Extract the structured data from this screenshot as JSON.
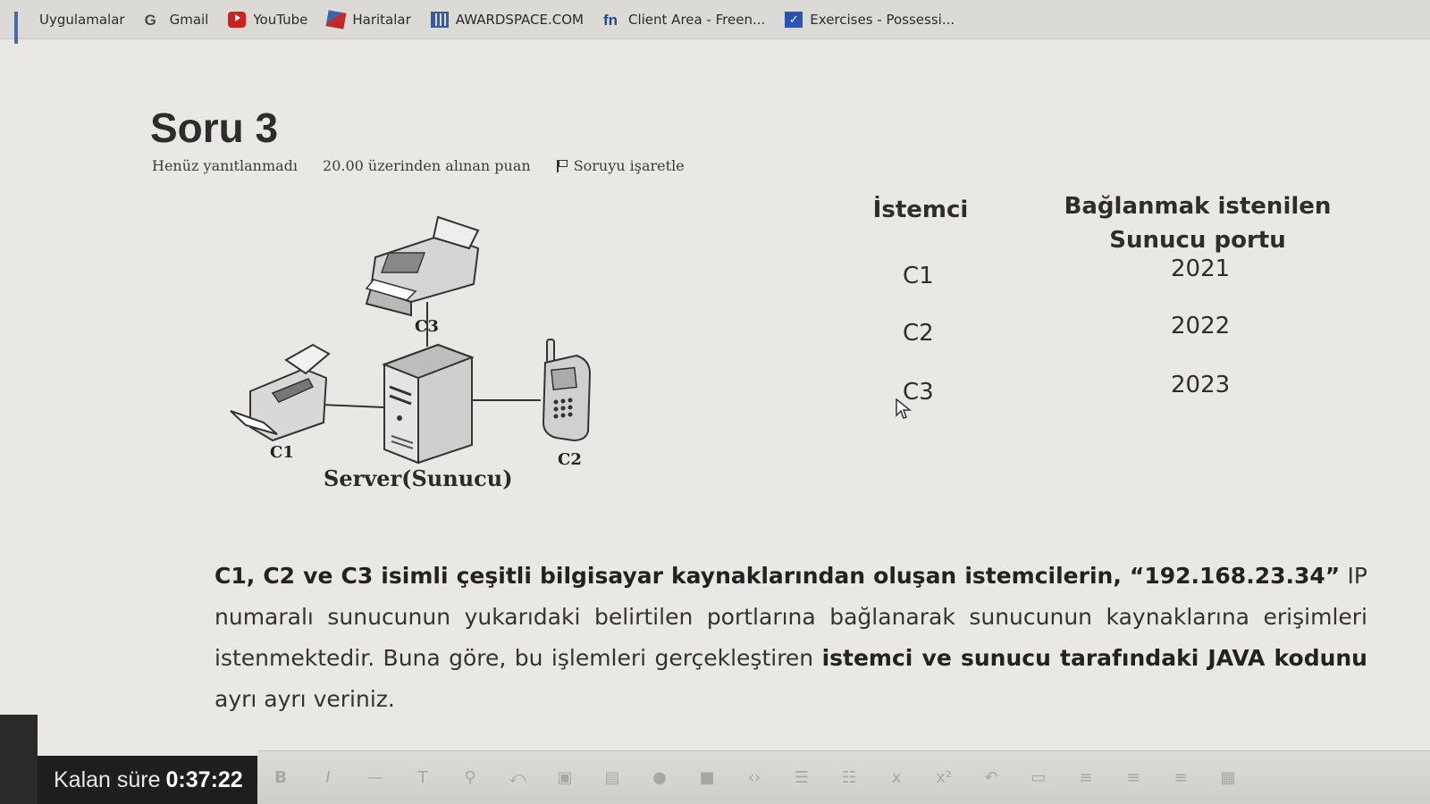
{
  "bookmarks": [
    {
      "label": "Uygulamalar",
      "icon": "apps-grid-icon"
    },
    {
      "label": "Gmail",
      "icon": "google-icon"
    },
    {
      "label": "YouTube",
      "icon": "youtube-icon"
    },
    {
      "label": "Haritalar",
      "icon": "maps-icon"
    },
    {
      "label": "AWARDSPACE.COM",
      "icon": "awardspace-icon"
    },
    {
      "label": "Client Area - Freen...",
      "icon": "freenom-icon"
    },
    {
      "label": "Exercises - Possessi...",
      "icon": "exercises-icon"
    }
  ],
  "question": {
    "title": "Soru 3",
    "status": "Henüz yanıtlanmadı",
    "points": "20.00 üzerinden alınan puan",
    "flag_label": "Soruyu işaretle"
  },
  "diagram": {
    "server_label": "Server(Sunucu)",
    "nodes": {
      "c1": "C1",
      "c2": "C2",
      "c3": "C3"
    }
  },
  "port_table": {
    "header_client": "İstemci",
    "header_port_line1": "Bağlanmak istenilen",
    "header_port_line2": "Sunucu portu",
    "rows": [
      {
        "client": "C1",
        "port": "2021"
      },
      {
        "client": "C2",
        "port": "2022"
      },
      {
        "client": "C3",
        "port": "2023"
      }
    ]
  },
  "question_text": {
    "p1_bold": "C1, C2 ve C3 isimli çeşitli bilgisayar kaynaklarından oluşan istemcilerin, “192.168.23.34”",
    "p2": " IP numaralı sunucunun yukarıdaki belirtilen portlarına bağlanarak sunucunun kaynaklarına erişimleri istenmektedir. Buna göre, bu işlemleri gerçekleştiren ",
    "p3_bold": "istemci ve sunucu tarafındaki JAVA kodunu",
    "p4": " ayrı ayrı veriniz."
  },
  "timer": {
    "label": "Kalan süre",
    "value": "0:37:22"
  },
  "toolbar": {
    "bold": "B",
    "italic": "I",
    "strike": "—",
    "text": "T"
  },
  "colors": {
    "accent_blue": "#2953b8",
    "youtube_red": "#d12020",
    "timer_bg": "#1e1e1e"
  }
}
